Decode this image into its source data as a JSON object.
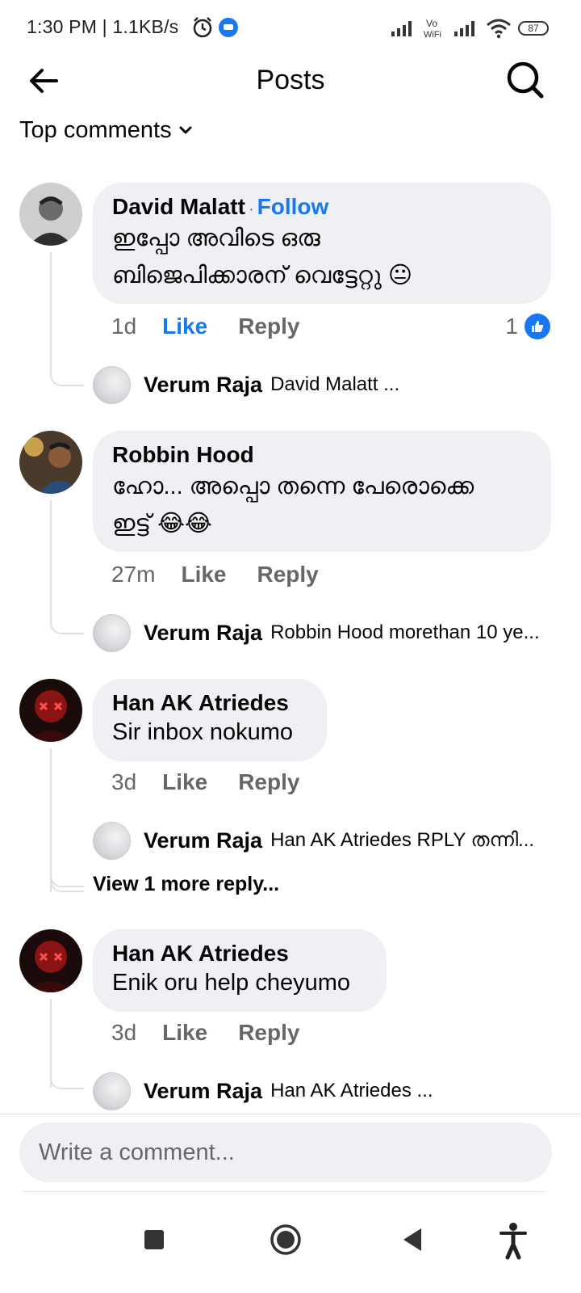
{
  "status_bar": {
    "time": "1:30 PM | 1.1KB/s",
    "battery": "87",
    "icons": [
      "alarm-icon",
      "messenger-icon",
      "signal-icon",
      "vowifi-icon",
      "signal-icon",
      "wifi-icon",
      "battery-icon"
    ]
  },
  "header": {
    "title": "Posts",
    "back_icon": "back-arrow-icon",
    "search_icon": "search-icon"
  },
  "sort": {
    "label": "Top comments"
  },
  "comments": [
    {
      "author": "David Malatt",
      "follow": "Follow",
      "text_lines": [
        "ഇപ്പോ അവിടെ ഒരു",
        "ബിജെപിക്കാരന് വെട്ടേറ്റു 😐"
      ],
      "time": "1d",
      "like": "Like",
      "reply": "Reply",
      "reaction_count": "1",
      "reply_preview": {
        "author": "Verum Raja",
        "text": "David Malatt ..."
      }
    },
    {
      "author": "Robbin Hood",
      "text_lines": [
        "ഹോ... അപ്പൊ തന്നെ പേരൊക്കെ",
        "ഇട്ട് 😂😂"
      ],
      "time": "27m",
      "like": "Like",
      "reply": "Reply",
      "reply_preview": {
        "author": "Verum Raja",
        "text": "Robbin Hood morethan 10 ye..."
      }
    },
    {
      "author": "Han AK Atriedes",
      "text_lines": [
        "Sir inbox nokumo"
      ],
      "time": "3d",
      "like": "Like",
      "reply": "Reply",
      "reply_preview": {
        "author": "Verum Raja",
        "text": "Han AK Atriedes RPLY തന്നി..."
      },
      "view_more": "View 1 more reply..."
    },
    {
      "author": "Han AK Atriedes",
      "text_lines": [
        "Enik oru help cheyumo"
      ],
      "time": "3d",
      "like": "Like",
      "reply": "Reply",
      "reply_preview": {
        "author": "Verum Raja",
        "text": "Han AK Atriedes ..."
      }
    }
  ],
  "composer": {
    "placeholder": "Write a comment..."
  },
  "system_nav": [
    "recents-square-icon",
    "home-circle-icon",
    "back-triangle-icon",
    "accessibility-icon"
  ],
  "colors": {
    "accent": "#1877f2",
    "bubble": "#eef0f3",
    "secondary_text": "#65676b"
  }
}
